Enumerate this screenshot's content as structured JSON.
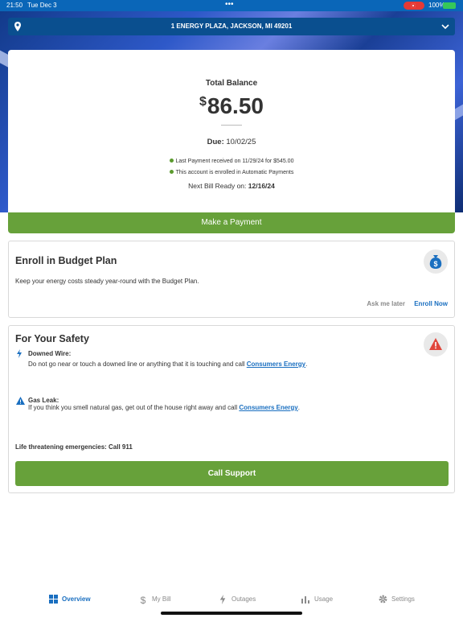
{
  "status_bar": {
    "time": "21:50",
    "date": "Tue Dec 3",
    "more": "•••",
    "battery": "100%"
  },
  "address": {
    "text": "1 ENERGY PLAZA, JACKSON, MI 49201"
  },
  "balance": {
    "title": "Total Balance",
    "currency": "$",
    "amount": "86.50",
    "due_label": "Due:",
    "due_date": "10/02/25",
    "last_payment": "Last Payment received on 11/29/24 for $545.00",
    "autopay": "This account is enrolled in Automatic Payments",
    "next_bill_label": "Next Bill Ready on:",
    "next_bill_date": "12/16/24"
  },
  "pay_button": "Make a Payment",
  "budget_plan": {
    "title": "Enroll in Budget Plan",
    "description": "Keep your energy costs steady year-round with the Budget Plan.",
    "ask_later": "Ask me later",
    "enroll_now": "Enroll Now"
  },
  "safety": {
    "title": "For Your Safety",
    "downed_wire_title": "Downed Wire:",
    "downed_wire_text": "Do not go near or touch a downed line or anything that it is touching and call",
    "gas_leak_title": "Gas Leak:",
    "gas_leak_text": "If you think you smell natural gas, get out of the house right away and call",
    "link_text": "Consumers Energy",
    "emergency": "Life threatening emergencies: Call 911",
    "call_button": "Call Support"
  },
  "tabs": [
    {
      "label": "Overview",
      "icon": "grid-icon",
      "active": true
    },
    {
      "label": "My Bill",
      "icon": "dollar-icon",
      "active": false
    },
    {
      "label": "Outages",
      "icon": "bolt-icon",
      "active": false
    },
    {
      "label": "Usage",
      "icon": "bar-chart-icon",
      "active": false
    },
    {
      "label": "Settings",
      "icon": "gear-icon",
      "active": false
    }
  ],
  "colors": {
    "primary_blue": "#0a66b8",
    "green": "#67a13a",
    "link_blue": "#1a6fc0",
    "alert_red": "#e0463c"
  }
}
